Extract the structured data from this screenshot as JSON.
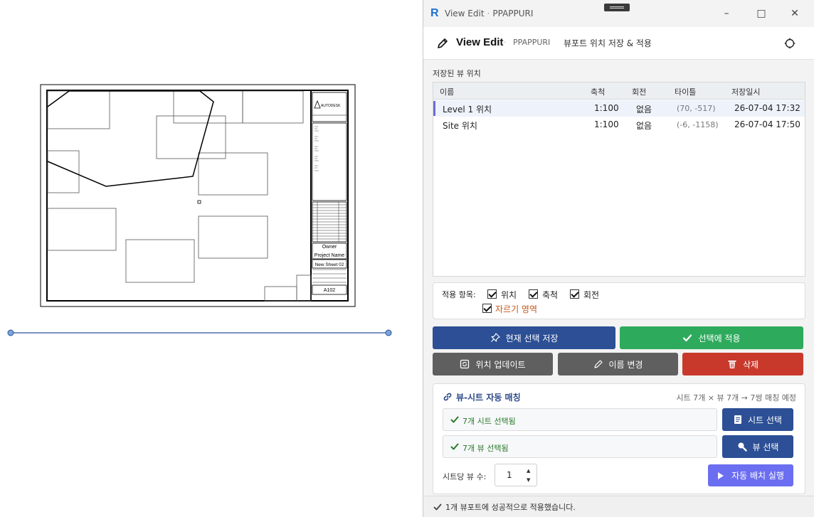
{
  "titlebar": {
    "app_logo": "R",
    "title": "View Edit",
    "brand": "PPAPPURI",
    "minimize_icon": "minimize-icon",
    "maximize_icon": "maximize-icon",
    "close_icon": "close-icon"
  },
  "header": {
    "title": "View Edit",
    "brand": "PPAPPURI",
    "subtitle": "뷰포트 위치 저장 & 적용"
  },
  "saved": {
    "section_label": "저장된 뷰 위치",
    "columns": [
      "이름",
      "축척",
      "회전",
      "타이틀",
      "저장일시"
    ],
    "rows": [
      {
        "name": "Level 1 위치",
        "scale": "1:100",
        "rotation": "없음",
        "title": "(70, -517)",
        "saved_at": "26-07-04 17:32",
        "selected": true
      },
      {
        "name": "Site 위치",
        "scale": "1:100",
        "rotation": "없음",
        "title": "(-6, -1158)",
        "saved_at": "26-07-04 17:50",
        "selected": false
      }
    ]
  },
  "options": {
    "label": "적용 항목:",
    "items": [
      {
        "label": "위치",
        "checked": true
      },
      {
        "label": "축척",
        "checked": true
      },
      {
        "label": "회전",
        "checked": true
      },
      {
        "label": "자르기 영역",
        "checked": true
      }
    ]
  },
  "actions": {
    "save_selection": "현재 선택 저장",
    "apply_selection": "선택에 적용",
    "update_position": "위치 업데이트",
    "rename": "이름 변경",
    "delete": "삭제"
  },
  "match": {
    "title": "뷰-시트 자동 매칭",
    "info": "시트 7개 × 뷰 7개 → 7쌍 매칭 예정",
    "sheet_status": "7개 시트 선택됨",
    "view_status": "7개 뷰 선택됨",
    "sheet_button": "시트 선택",
    "view_button": "뷰 선택",
    "per_sheet_label": "시트당 뷰 수:",
    "per_sheet_value": "1",
    "run_button": "자동 배치 실행"
  },
  "status": {
    "message": "1개 뷰포트에 성공적으로 적용했습니다."
  },
  "sheet": {
    "title_block": {
      "company": "AUTODESK",
      "owner": "Owner",
      "project": "Project Name",
      "sheet_name": "New Sheet 02",
      "sheet_number": "A102"
    }
  },
  "colors": {
    "primary_blue": "#2c4f95",
    "green": "#2eaa5c",
    "gray": "#5f5f5f",
    "red": "#c8392c",
    "violet": "#6b6ef0",
    "accent_row": "#6d6dd6"
  }
}
